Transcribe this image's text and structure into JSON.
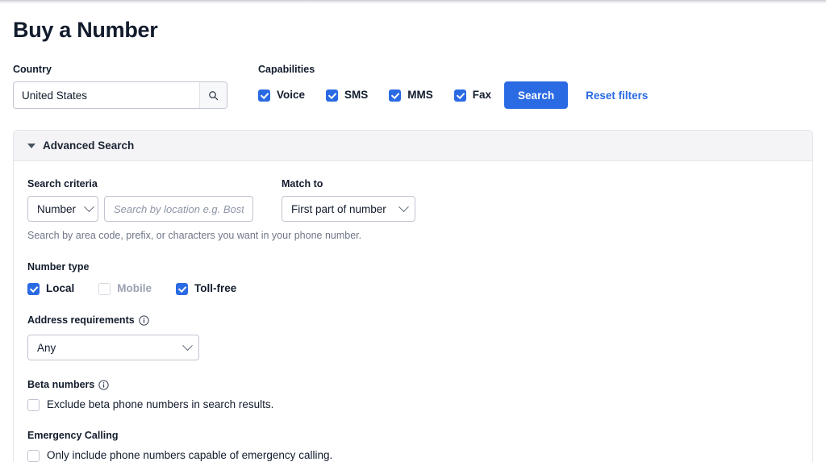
{
  "page": {
    "title": "Buy a Number"
  },
  "country": {
    "label": "Country",
    "value": "United States",
    "search_icon": "search-icon"
  },
  "capabilities": {
    "label": "Capabilities",
    "items": [
      {
        "label": "Voice",
        "checked": true
      },
      {
        "label": "SMS",
        "checked": true
      },
      {
        "label": "MMS",
        "checked": true
      },
      {
        "label": "Fax",
        "checked": true
      }
    ],
    "search_button": "Search",
    "reset_link": "Reset filters"
  },
  "advanced_search": {
    "header": "Advanced Search",
    "expanded": true,
    "search_criteria": {
      "label": "Search criteria",
      "type_select_value": "Number",
      "query_value": "",
      "query_placeholder": "Search by location e.g. Boston",
      "helper": "Search by area code, prefix, or characters you want in your phone number."
    },
    "match_to": {
      "label": "Match to",
      "value": "First part of number"
    },
    "number_type": {
      "label": "Number type",
      "items": [
        {
          "label": "Local",
          "checked": true,
          "disabled": false
        },
        {
          "label": "Mobile",
          "checked": false,
          "disabled": true
        },
        {
          "label": "Toll-free",
          "checked": true,
          "disabled": false
        }
      ]
    },
    "address_requirements": {
      "label": "Address requirements",
      "info_icon": "info-icon",
      "value": "Any"
    },
    "beta_numbers": {
      "label": "Beta numbers",
      "info_icon": "info-icon",
      "checkbox_label": "Exclude beta phone numbers in search results.",
      "checked": false
    },
    "emergency_calling": {
      "label": "Emergency Calling",
      "checkbox_label": "Only include phone numbers capable of emergency calling.",
      "checked": false
    }
  },
  "colors": {
    "accent": "#2a6ae3",
    "text": "#121c2d",
    "muted": "#6e7687",
    "panel_header_bg": "#f4f4f7",
    "border": "#c1c5d0"
  }
}
